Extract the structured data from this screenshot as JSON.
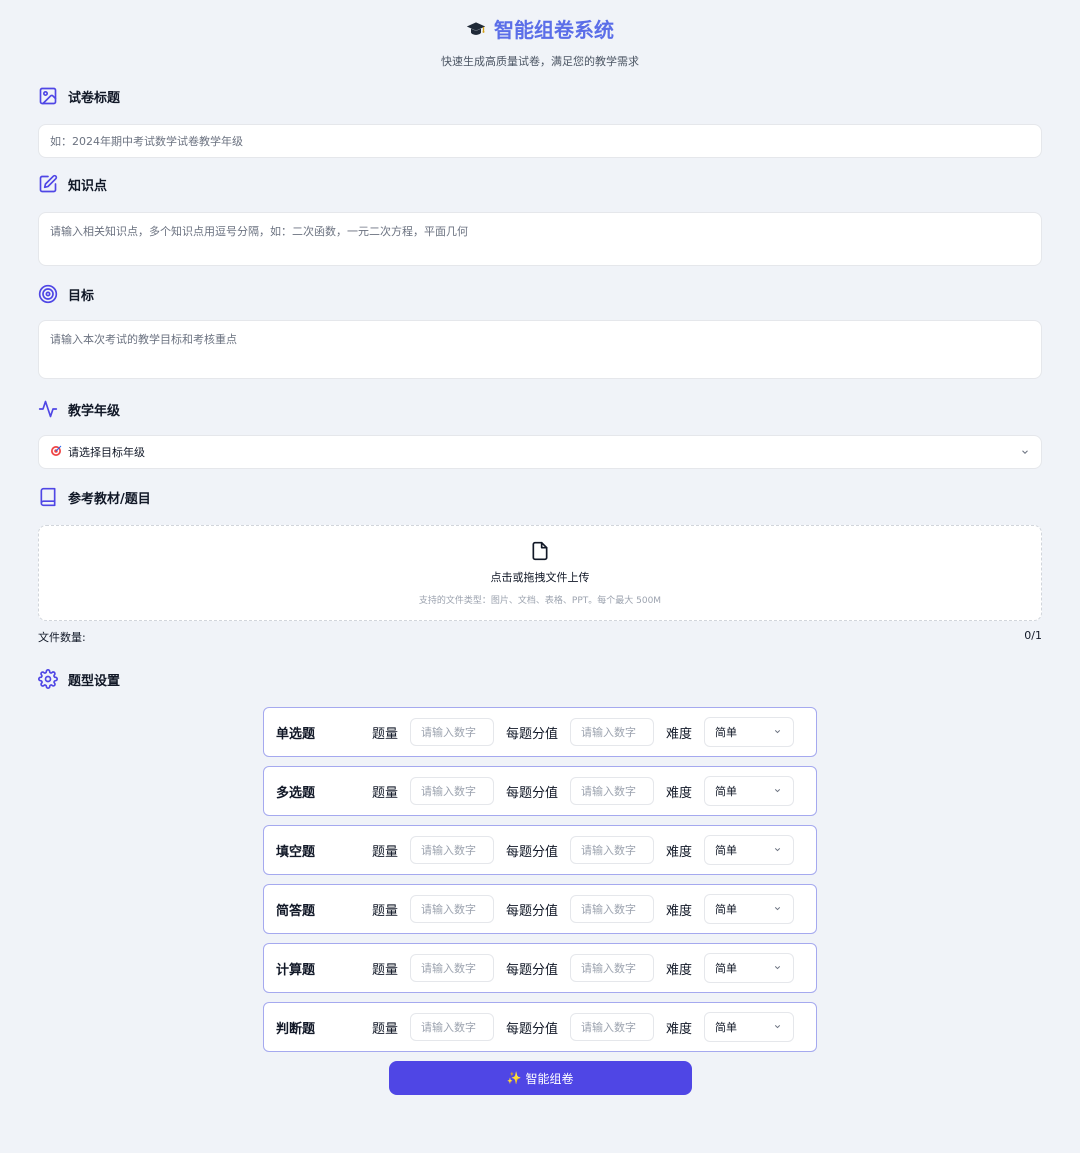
{
  "header": {
    "title": "智能组卷系统",
    "subtitle": "快速生成高质量试卷，满足您的教学需求"
  },
  "sections": {
    "paper_title": {
      "label": "试卷标题",
      "placeholder": "如：2024年期中考试数学试卷教学年级"
    },
    "knowledge": {
      "label": "知识点",
      "placeholder": "请输入相关知识点，多个知识点用逗号分隔，如：二次函数，一元二次方程，平面几何"
    },
    "goal": {
      "label": "目标",
      "placeholder": "请输入本次考试的教学目标和考核重点"
    },
    "grade": {
      "label": "教学年级",
      "selected": "请选择目标年级"
    },
    "reference": {
      "label": "参考教材/题目",
      "upload_text": "点击或拖拽文件上传",
      "upload_hint": "支持的文件类型：图片、文档、表格、PPT。每个最大 500M",
      "file_count_label": "文件数量:",
      "file_count_value": "0/1"
    },
    "question_types": {
      "label": "题型设置"
    }
  },
  "qfields": {
    "count_label": "题量",
    "score_label": "每题分值",
    "difficulty_label": "难度",
    "input_placeholder": "请输入数字"
  },
  "question_rows": [
    {
      "name": "单选题",
      "difficulty": "简单"
    },
    {
      "name": "多选题",
      "difficulty": "简单"
    },
    {
      "name": "填空题",
      "difficulty": "简单"
    },
    {
      "name": "简答题",
      "difficulty": "简单"
    },
    {
      "name": "计算题",
      "difficulty": "简单"
    },
    {
      "name": "判断题",
      "difficulty": "简单"
    }
  ],
  "submit": {
    "icon": "✨",
    "label": "智能组卷"
  },
  "colors": {
    "accent": "#4f46e5",
    "title": "#5b6ee8",
    "row_border": "#a5a9ef",
    "background": "#f0f3f8"
  },
  "icons": {
    "title": "graduation-cap-icon",
    "paper_title": "image-icon",
    "knowledge": "edit-icon",
    "goal": "target-icon",
    "grade": "activity-icon",
    "grade_select": "dart-icon",
    "reference": "book-icon",
    "upload": "file-icon",
    "question_types": "gear-icon"
  }
}
